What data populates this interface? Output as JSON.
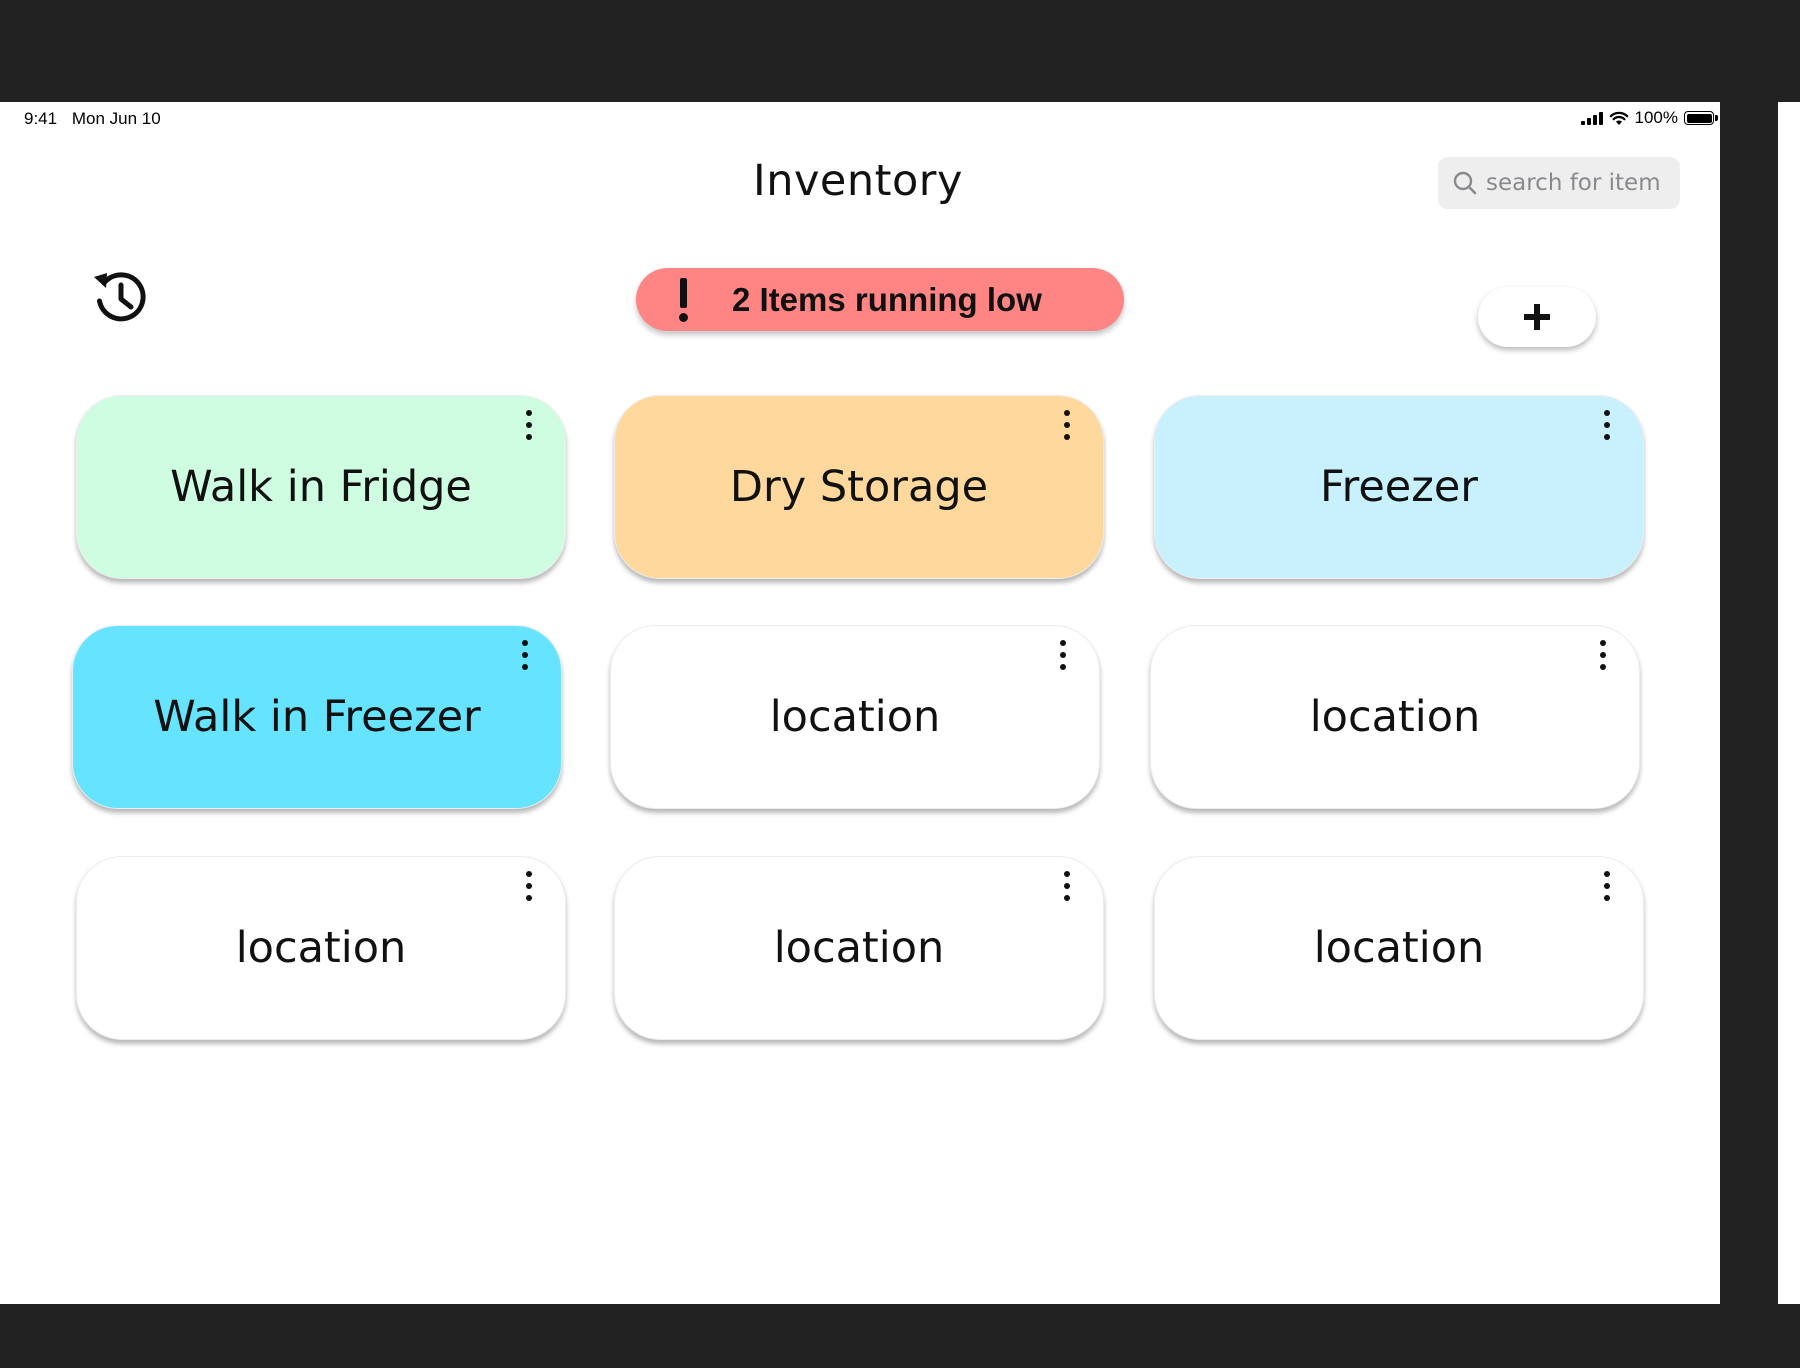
{
  "status_bar": {
    "time": "9:41",
    "date": "Mon Jun 10",
    "battery": "100%"
  },
  "header": {
    "title": "Inventory",
    "search_placeholder": "search for item"
  },
  "alert": {
    "text": "2 Items running low",
    "color": "#ff8585"
  },
  "locations": [
    {
      "label": "Walk in Fridge",
      "color": "#cffde1"
    },
    {
      "label": "Dry Storage",
      "color": "#fed89c"
    },
    {
      "label": "Freezer",
      "color": "#c8f1fd"
    },
    {
      "label": "Walk in Freezer",
      "color": "#66e3ff"
    },
    {
      "label": "location",
      "color": "#ffffff"
    },
    {
      "label": "location",
      "color": "#ffffff"
    },
    {
      "label": "location",
      "color": "#ffffff"
    },
    {
      "label": "location",
      "color": "#ffffff"
    },
    {
      "label": "location",
      "color": "#ffffff"
    }
  ],
  "icons": {
    "history": "history-icon",
    "add": "plus-icon",
    "more": "more-vertical-icon",
    "search": "search-icon",
    "alert": "exclamation-icon"
  }
}
